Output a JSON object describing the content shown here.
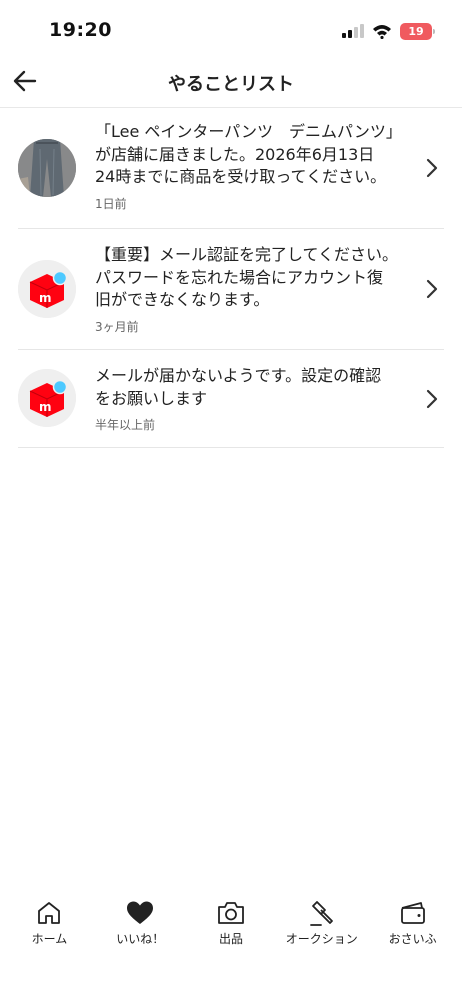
{
  "status_bar": {
    "time": "19:20",
    "battery_level": "19",
    "battery_color": "#f05a5f",
    "icons": [
      "cellular-signal-icon",
      "wifi-icon",
      "battery-icon"
    ]
  },
  "header": {
    "title": "やることリスト",
    "back_icon": "back-arrow-icon"
  },
  "todo_items": [
    {
      "message": "「Lee ペインターパンツ　デニムパンツ」\nが店舗に届きました。2026年6月13日\n24時までに商品を受け取ってください。",
      "time": "1日前",
      "avatar": "product-photo"
    },
    {
      "message": "【重要】メール認証を完了してください。\nパスワードを忘れた場合にアカウント復\n旧ができなくなります。",
      "time": "3ヶ月前",
      "avatar": "mercari-logo"
    },
    {
      "message": "メールが届かないようです。設定の確認\nをお願いします",
      "time": "半年以上前",
      "avatar": "mercari-logo"
    }
  ],
  "brand": {
    "red": "#ff0211",
    "badge_blue": "#4dc9ff"
  },
  "tab_bar": {
    "tabs": [
      {
        "label": "ホーム",
        "icon": "home-icon"
      },
      {
        "label": "いいね！",
        "icon": "heart-icon"
      },
      {
        "label": "出品",
        "icon": "camera-icon"
      },
      {
        "label": "オークション",
        "icon": "gavel-icon"
      },
      {
        "label": "おさいふ",
        "icon": "wallet-icon"
      }
    ]
  }
}
